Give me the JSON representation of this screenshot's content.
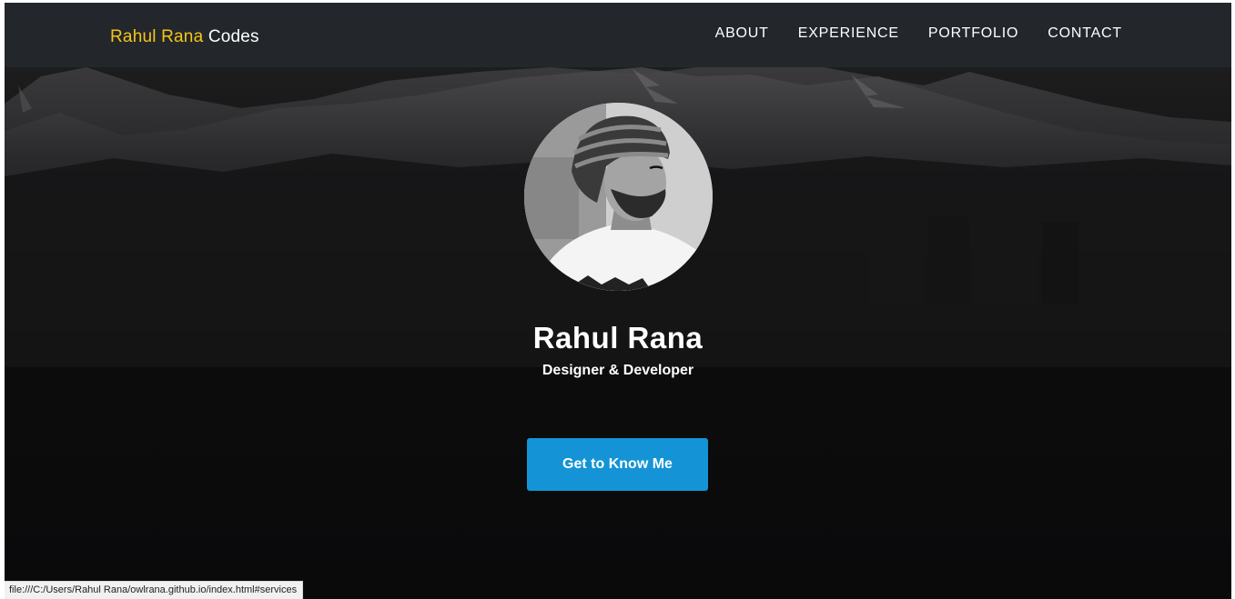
{
  "navbar": {
    "brand_first": "Rahul Rana",
    "brand_second": "Codes",
    "links": [
      {
        "label": "ABOUT"
      },
      {
        "label": "EXPERIENCE"
      },
      {
        "label": "PORTFOLIO"
      },
      {
        "label": "CONTACT"
      }
    ]
  },
  "hero": {
    "name": "Rahul Rana",
    "role": "Designer & Developer",
    "cta_label": "Get to Know Me",
    "avatar_icon": "profile-photo"
  },
  "status_bar": {
    "url": "file:///C:/Users/Rahul Rana/owlrana.github.io/index.html#services"
  },
  "colors": {
    "brand_accent": "#f5c518",
    "navbar_bg": "#23272b",
    "cta_bg": "#1494d6",
    "hero_bg": "#0b0b0c"
  }
}
